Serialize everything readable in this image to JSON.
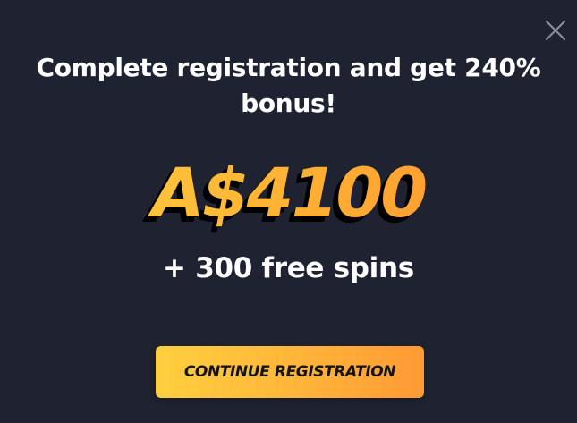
{
  "close_icon": "close-icon",
  "headline": {
    "line1": "Complete registration and get 240%",
    "line2": "bonus!"
  },
  "bonus": {
    "amount": "A$4100",
    "extra": "+ 300 free spins"
  },
  "cta": {
    "label": "CONTINUE REGISTRATION"
  },
  "colors": {
    "background": "#1f2230",
    "accent_start": "#ffd54a",
    "accent_end": "#ff8f2f",
    "text": "#ffffff"
  }
}
